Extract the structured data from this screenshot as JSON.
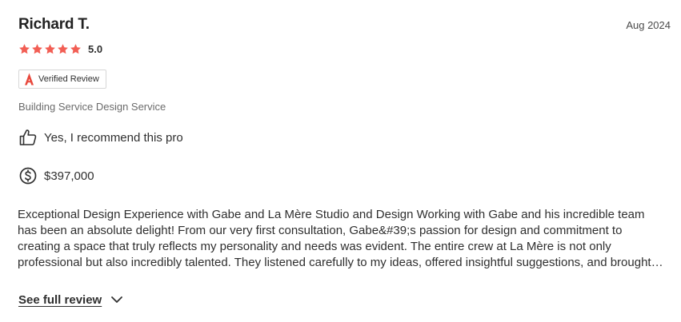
{
  "review": {
    "reviewer_name": "Richard T.",
    "date": "Aug 2024",
    "rating": 5,
    "rating_label": "5.0",
    "verified_label": "Verified Review",
    "service": "Building Service Design Service",
    "recommend_text": "Yes, I recommend this pro",
    "price": "$397,000",
    "body": "Exceptional Design Experience with Gabe and La Mère Studio and Design Working with Gabe and his incredible team has been an absolute delight! From our very first consultation, Gabe&#39;s passion for design and commitment to creating a space that truly reflects my personality and needs was evident. The entire crew at La Mère is not only professional but also incredibly talented. They listened carefully to my ideas, offered insightful suggestions, and brought my vision to life.",
    "see_full_label": "See full review"
  },
  "colors": {
    "star": "#f25e54",
    "badge_icon": "#e8473b",
    "text": "#2f2f2f",
    "muted": "#6b6b6b"
  },
  "icons": {
    "star": "star-icon",
    "verified": "houzz-verified-icon",
    "recommend": "thumbs-up-icon",
    "price": "dollar-circle-icon",
    "expand": "chevron-down-icon"
  }
}
